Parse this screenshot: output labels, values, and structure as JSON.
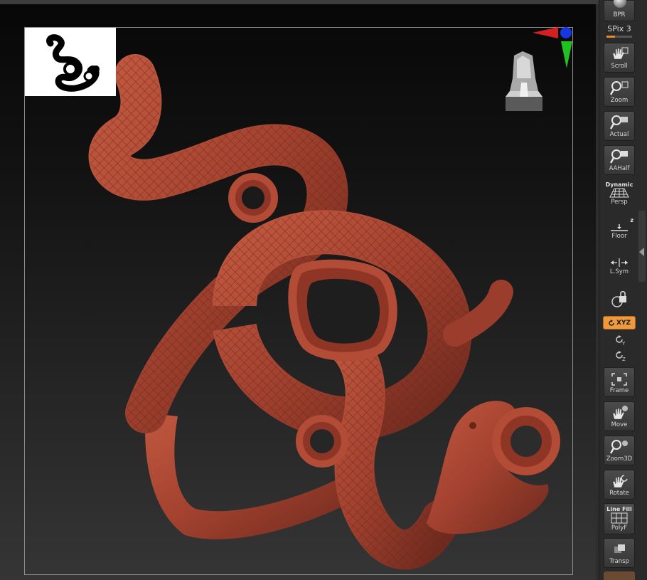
{
  "viewport": {
    "model_color": "#a2412f",
    "thumbnail_icon": "snake-silhouette-icon"
  },
  "sidebar": {
    "bpr_label": "BPR",
    "spix_label": "SPix 3",
    "spix_level": 0.33,
    "buttons": {
      "scroll": "Scroll",
      "zoom": "Zoom",
      "actual": "Actual",
      "aahalf": "AAHalf",
      "persp_top": "Dynamic",
      "persp": "Persp",
      "floor_top": "z",
      "floor": "Floor",
      "lsym": "L.Sym",
      "xyz": "XYZ",
      "frame": "Frame",
      "move": "Move",
      "zoom3d": "Zoom3D",
      "rotate": "Rotate",
      "polyf_top": "Line Fill",
      "polyf": "PolyF",
      "transp": "Transp"
    },
    "active_color": "#f09a3e"
  }
}
